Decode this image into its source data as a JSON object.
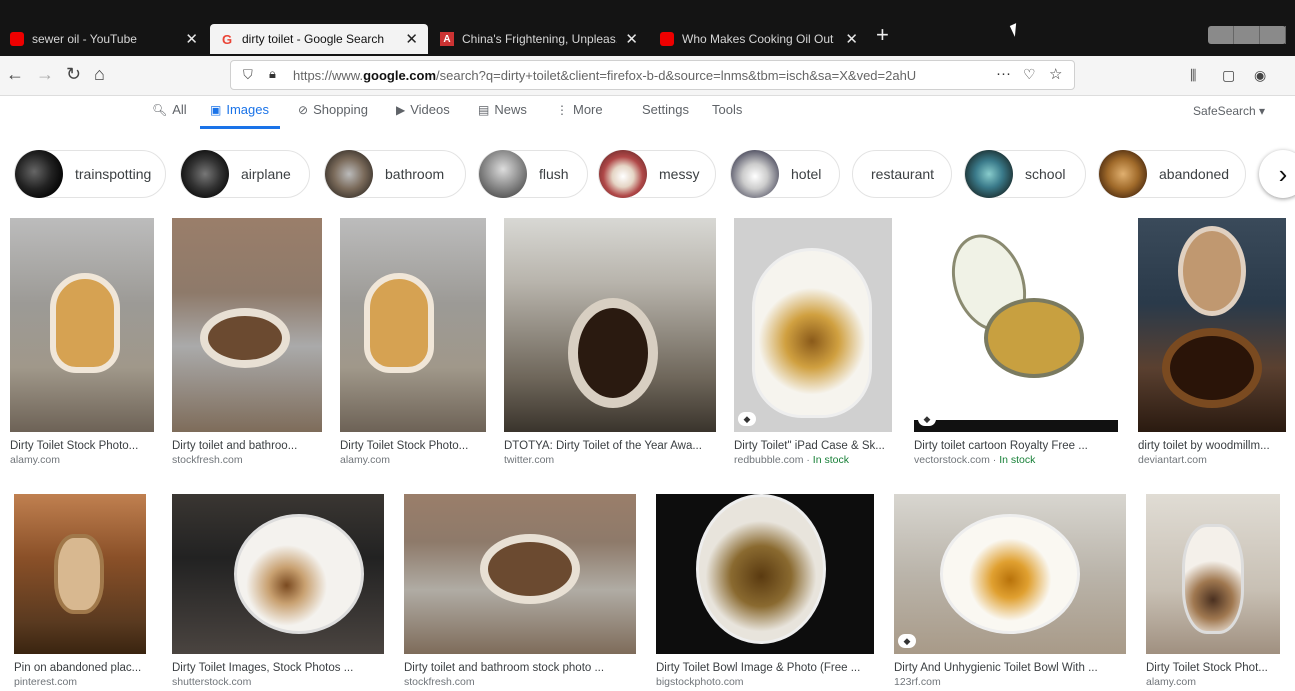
{
  "browser": {
    "tabs": [
      {
        "title": "sewer oil - YouTube",
        "favicon": "youtube-icon"
      },
      {
        "title": "dirty toilet - Google Search",
        "favicon": "google-icon",
        "active": true
      },
      {
        "title": "China's Frightening, Unpleas...",
        "favicon": "article-icon"
      },
      {
        "title": "Who Makes Cooking Oil Out",
        "favicon": "youtube-icon"
      }
    ],
    "url_prefix": "https://www.",
    "url_domain": "google.com",
    "url_rest": "/search?q=dirty+toilet&client=firefox-b-d&source=lnms&tbm=isch&sa=X&ved=2ahU",
    "url_menu": "···"
  },
  "google_nav": {
    "all": "All",
    "images": "Images",
    "shopping": "Shopping",
    "videos": "Videos",
    "news": "News",
    "more": "More",
    "settings": "Settings",
    "tools": "Tools",
    "safesearch": "SafeSearch ▾"
  },
  "chips": [
    "trainspotting",
    "airplane",
    "bathroom",
    "flush",
    "messy",
    "hotel",
    "restaurant",
    "school",
    "abandoned"
  ],
  "results": [
    {
      "caption": "Dirty Toilet Stock Photo...",
      "source": "alamy.com"
    },
    {
      "caption": "Dirty toilet and bathroo...",
      "source": "stockfresh.com"
    },
    {
      "caption": "Dirty Toilet Stock Photo...",
      "source": "alamy.com"
    },
    {
      "caption": "DTOTYA: Dirty Toilet of the Year Awa...",
      "source": "twitter.com"
    },
    {
      "caption": "Dirty Toilet\" iPad Case & Sk...",
      "source": "redbubble.com · ",
      "stock": "In stock"
    },
    {
      "caption": "Dirty toilet cartoon Royalty Free ...",
      "source": "vectorstock.com · ",
      "stock": "In stock"
    },
    {
      "caption": "dirty toilet by woodmillm...",
      "source": "deviantart.com"
    },
    {
      "caption": "Pin on abandoned plac...",
      "source": "pinterest.com"
    },
    {
      "caption": "Dirty Toilet Images, Stock Photos ...",
      "source": "shutterstock.com"
    },
    {
      "caption": "Dirty toilet and bathroom stock photo ...",
      "source": "stockfresh.com"
    },
    {
      "caption": "Dirty Toilet Bowl Image & Photo (Free ...",
      "source": "bigstockphoto.com"
    },
    {
      "caption": "Dirty And Unhygienic Toilet Bowl With ...",
      "source": "123rf.com"
    },
    {
      "caption": "Dirty Toilet Stock Phot...",
      "source": "alamy.com"
    }
  ],
  "colors": {
    "accent": "#1a73e8",
    "tabbar": "#141414",
    "stock": "#188038"
  }
}
